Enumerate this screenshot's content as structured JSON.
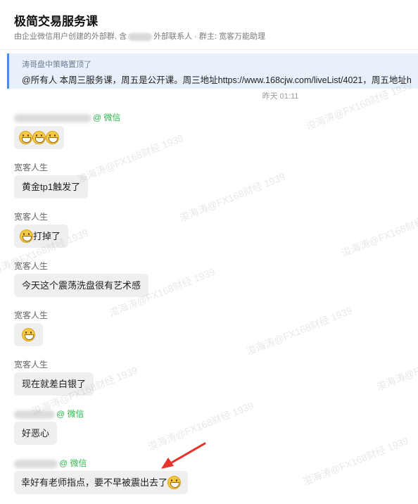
{
  "header": {
    "title": "极简交易服务课",
    "subtitle_prefix": "由企业微信用户创建的外部群, 含",
    "subtitle_suffix": "外部联系人 · 群主: 宽客万能助理"
  },
  "pinned": {
    "label": "涛哥盘中策略置顶了",
    "text": "@所有人  本周三服务课，周五是公开课。周三地址https://www.168cjw.com/liveList/4021，周五地址h"
  },
  "timestamp": "昨天 01:11",
  "messages": [
    {
      "sender_suffix": "old trading",
      "wechat": "@ 微信",
      "content": ""
    },
    {
      "sender": "宽客人生",
      "content": "黄金tp1触发了"
    },
    {
      "sender": "宽客人生",
      "content": "打掉了"
    },
    {
      "sender": "宽客人生",
      "content": "今天这个震荡洗盘很有艺术感"
    },
    {
      "sender": "宽客人生",
      "content": ""
    },
    {
      "sender": "宽客人生",
      "content": "现在就差白银了"
    },
    {
      "wechat": "@ 微信",
      "content": "好恶心"
    },
    {
      "wechat": "@ 微信",
      "content": "幸好有老师指点，要不早被震出去了"
    }
  ],
  "watermark": "浚海涛@FX168财经 1939",
  "colors": {
    "wechat_green": "#2eb84c",
    "pinned_bg": "#e7f0fb",
    "pinned_bar": "#4a90e2",
    "arrow": "#e8322b"
  },
  "icons": [
    "grin-emoji",
    "laugh-cry-emoji",
    "red-arrow"
  ]
}
